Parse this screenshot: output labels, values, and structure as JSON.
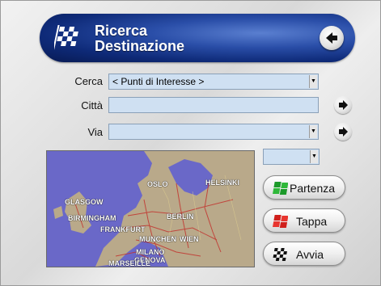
{
  "header": {
    "title_line1": "Ricerca",
    "title_line2": "Destinazione",
    "logo_icon": "checkered-flag-icon",
    "back_icon": "back-arrow-icon"
  },
  "form": {
    "cerca_label": "Cerca",
    "cerca_value": "< Punti di Interesse >",
    "citta_label": "Città",
    "citta_value": "",
    "via_label": "Via",
    "via_value": ""
  },
  "map": {
    "cities": [
      "OSLO",
      "HELSINKI",
      "GLASGOW",
      "BIRMINGHAM",
      "BERLIN",
      "FRANKFURT",
      "MUNCHEN",
      "WIEN",
      "MILANO",
      "GENOVA",
      "MARSEILLE"
    ]
  },
  "buttons": {
    "partenza": "Partenza",
    "tappa": "Tappa",
    "avvia": "Avvia"
  },
  "colors": {
    "header_blue": "#0e2a78",
    "field_bg": "#cfe0f2",
    "sea": "#6a68c8",
    "land": "#b9a98a"
  }
}
